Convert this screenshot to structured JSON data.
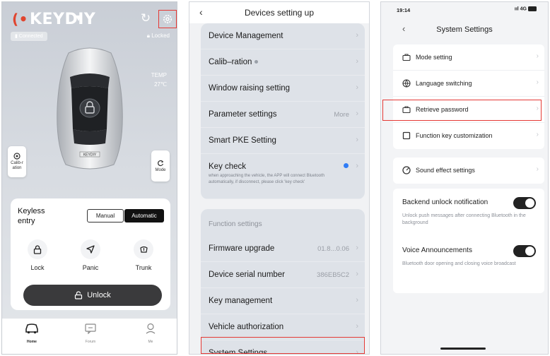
{
  "panel1": {
    "logo": "KEYDIY",
    "logo_mark": "(•",
    "status_chip": "Connected",
    "lock_state": "Locked",
    "temp_label": "TEMP",
    "temp_value": "27℃",
    "calibration_label": "Calib-r ation",
    "mode_label": "Mode",
    "car_plate": "KEYDIY",
    "keyless_label": "Keyless entry",
    "manual_label": "Manual",
    "automatic_label": "Automatic",
    "actions": [
      {
        "label": "Lock",
        "icon": "lock-icon"
      },
      {
        "label": "Panic",
        "icon": "navigation-arrow-icon"
      },
      {
        "label": "Trunk",
        "icon": "trunk-icon"
      }
    ],
    "unlock_label": "Unlock",
    "tabs": [
      {
        "label": "Home",
        "icon": "car-icon"
      },
      {
        "label": "Forum",
        "icon": "chat-icon"
      },
      {
        "label": "Me",
        "icon": "person-icon"
      }
    ]
  },
  "panel2": {
    "title": "Devices setting up",
    "rows": [
      {
        "label": "Device Management"
      },
      {
        "label": "Calib–ration"
      },
      {
        "label": "Window raising setting"
      },
      {
        "label": "Parameter settings",
        "value": "More"
      },
      {
        "label": "Smart PKE Setting"
      }
    ],
    "key_check": {
      "label": "Key check",
      "description": "when approaching the vehicle, the APP will connect Bluetooth automatically, if disconnect, please click 'key check'"
    },
    "function_section": "Function settings",
    "function_rows": [
      {
        "label": "Firmware upgrade",
        "value": "01.8...0.06"
      },
      {
        "label": "Device serial number",
        "value": "386EB5C2"
      },
      {
        "label": "Key management"
      },
      {
        "label": "Vehicle authorization"
      },
      {
        "label": "System Settings"
      }
    ]
  },
  "panel3": {
    "time": "19:14",
    "network": "4G",
    "title": "System Settings",
    "rows": [
      {
        "label": "Mode setting",
        "icon": "briefcase-icon"
      },
      {
        "label": "Language switching",
        "icon": "globe-icon"
      },
      {
        "label": "Retrieve password",
        "icon": "briefcase-icon"
      },
      {
        "label": "Function key customization",
        "icon": "square-icon"
      }
    ],
    "sound_label": "Sound effect settings",
    "backend": {
      "label": "Backend unlock notification",
      "description": "Unlock push messages after connecting Bluetooth in the background",
      "enabled": true
    },
    "voice": {
      "label": "Voice Announcements",
      "description": "Bluetooth door opening and closing voice broadcast",
      "enabled": true
    }
  },
  "colors": {
    "highlight": "#e53935",
    "accent_blue": "#2f7cf6",
    "dark": "#1e1e1e"
  }
}
